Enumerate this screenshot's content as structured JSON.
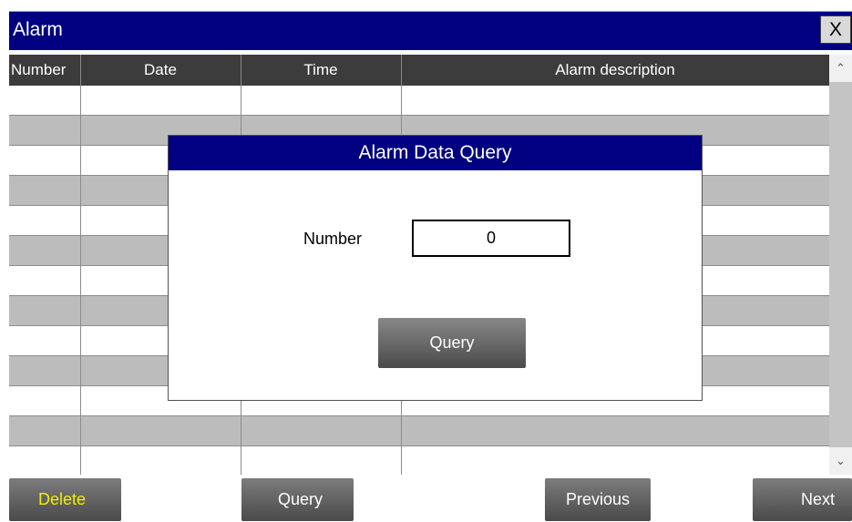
{
  "window": {
    "title": "Alarm",
    "close_label": "X"
  },
  "table": {
    "columns": [
      "Number",
      "Date",
      "Time",
      "Alarm description"
    ],
    "rows": [
      [
        "",
        "",
        "",
        ""
      ],
      [
        "",
        "",
        "",
        ""
      ],
      [
        "",
        "",
        "",
        ""
      ],
      [
        "",
        "",
        "",
        ""
      ],
      [
        "",
        "",
        "",
        ""
      ],
      [
        "",
        "",
        "",
        ""
      ],
      [
        "",
        "",
        "",
        ""
      ],
      [
        "",
        "",
        "",
        ""
      ],
      [
        "",
        "",
        "",
        ""
      ],
      [
        "",
        "",
        "",
        ""
      ],
      [
        "",
        "",
        "",
        ""
      ],
      [
        "",
        "",
        "",
        ""
      ],
      [
        "",
        "",
        "",
        ""
      ]
    ]
  },
  "scrollbar": {
    "up_icon": "chevron-up-icon",
    "down_icon": "chevron-down-icon"
  },
  "dialog": {
    "title": "Alarm Data Query",
    "number_label": "Number",
    "number_value": "0",
    "query_label": "Query"
  },
  "toolbar": {
    "delete_label": "Delete",
    "query_label": "Query",
    "previous_label": "Previous",
    "next_label": "Next"
  },
  "colors": {
    "titlebar": "#000080",
    "header_row": "#3c3c3c",
    "alt_row": "#bcbcbc",
    "delete_text": "#f0f000"
  }
}
